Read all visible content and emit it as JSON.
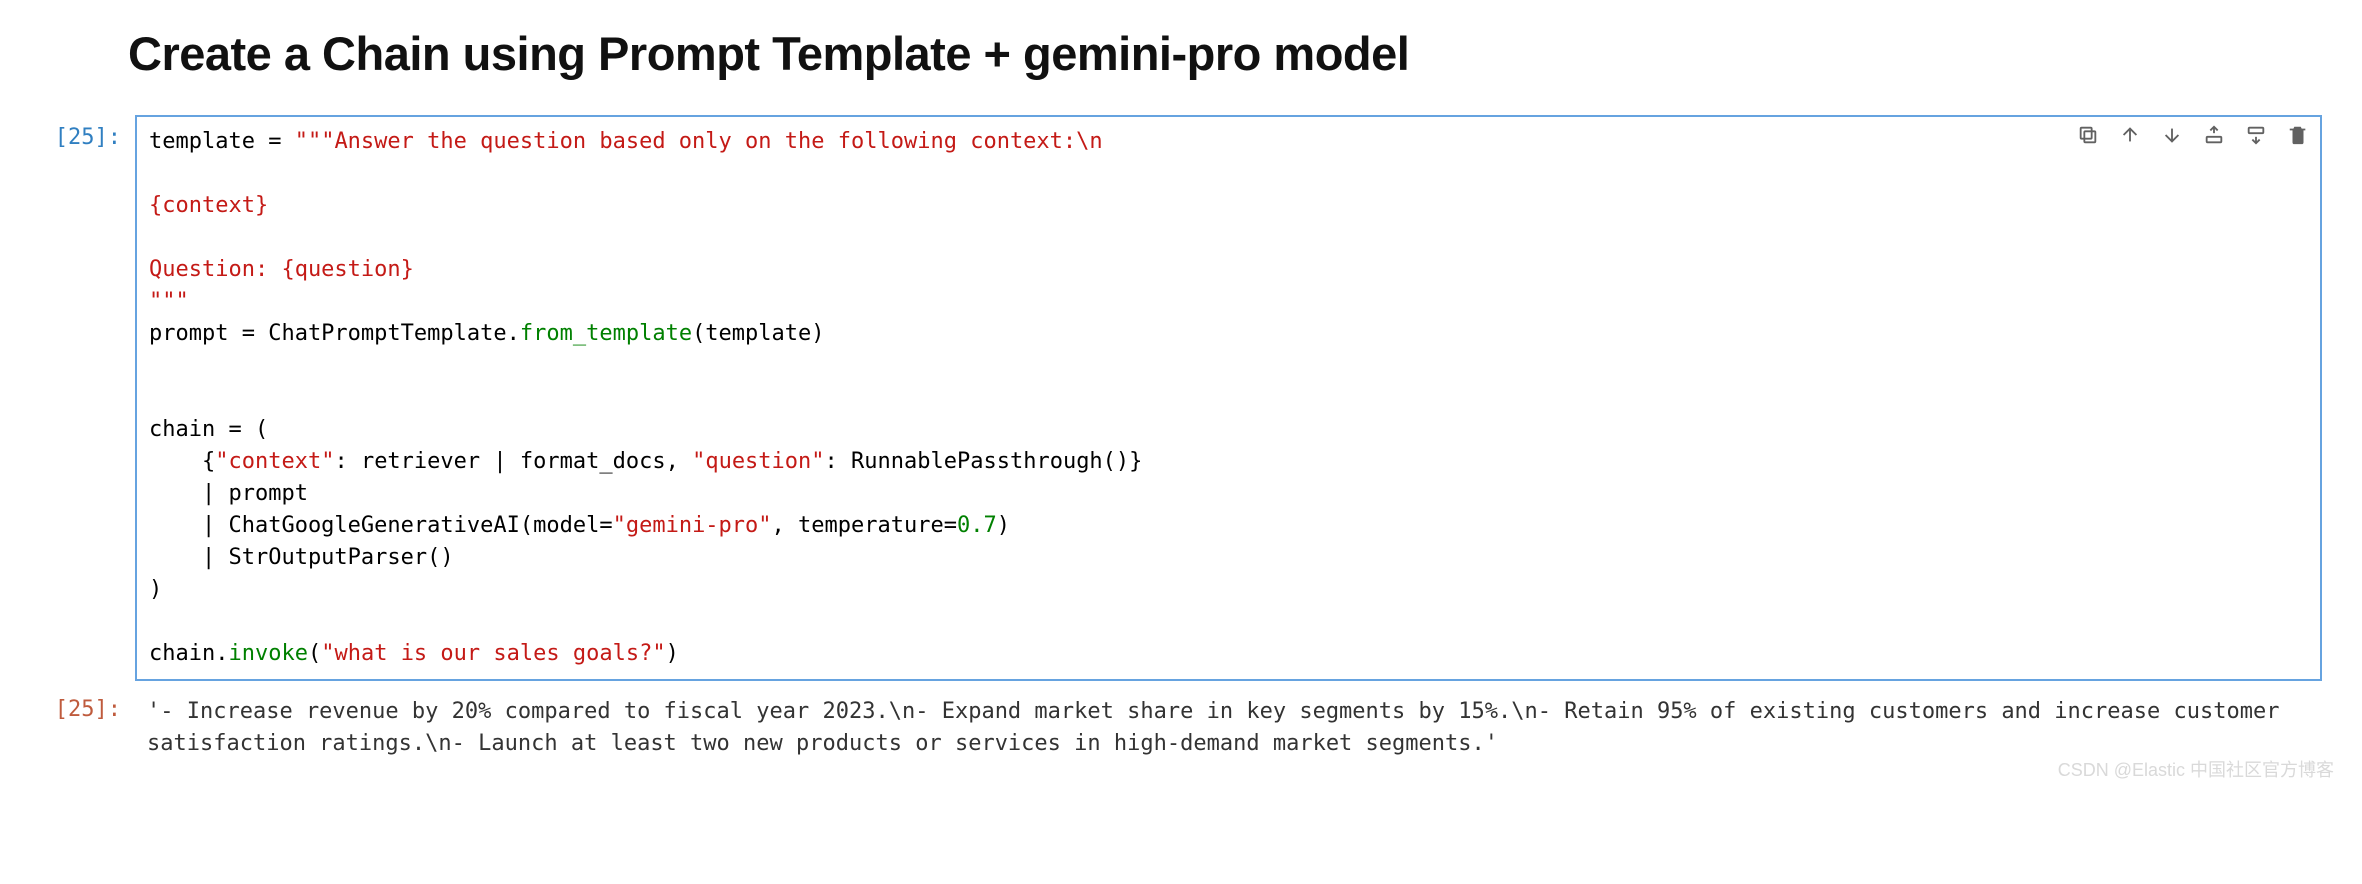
{
  "heading": "Create a Chain using Prompt Template + gemini-pro model",
  "input": {
    "prompt_label": "[25]:",
    "code": {
      "line1_a": "template = ",
      "line1_b": "\"\"\"Answer the question based only on the following context:\\n",
      "line2": "",
      "line3": "{context}",
      "line4": "",
      "line5": "Question: {question}",
      "line6": "\"\"\"",
      "line7_a": "prompt = ChatPromptTemplate.",
      "line7_b": "from_template",
      "line7_c": "(template)",
      "line8": "",
      "line9": "",
      "line10": "chain = (",
      "line11_a": "    {",
      "line11_b": "\"context\"",
      "line11_c": ": retriever | format_docs,",
      "line11_cursor": "|",
      "line11_d": " ",
      "line11_e": "\"question\"",
      "line11_f": ": RunnablePassthrough()}",
      "line12": "    | prompt",
      "line13_a": "    | ChatGoogleGenerativeAI(model=",
      "line13_b": "\"gemini-pro\"",
      "line13_c": ", temperature=",
      "line13_d": "0.7",
      "line13_e": ")",
      "line14": "    | StrOutputParser()",
      "line15": ")",
      "line16": "",
      "line17_a": "chain.",
      "line17_b": "invoke",
      "line17_c": "(",
      "line17_d": "\"what is our sales goals?\"",
      "line17_e": ")"
    }
  },
  "output": {
    "prompt_label": "[25]:",
    "text": "'- Increase revenue by 20% compared to fiscal year 2023.\\n- Expand market share in key segments by 15%.\\n- Retain 95% of existing customers and increase customer satisfaction ratings.\\n- Launch at least two new products or services in high-demand market segments.'"
  },
  "toolbar": {
    "duplicate": "Duplicate cell",
    "move_up": "Move up",
    "move_down": "Move down",
    "insert_above": "Insert above",
    "insert_below": "Insert below",
    "delete": "Delete cell"
  },
  "watermark": "CSDN @Elastic 中国社区官方博客"
}
